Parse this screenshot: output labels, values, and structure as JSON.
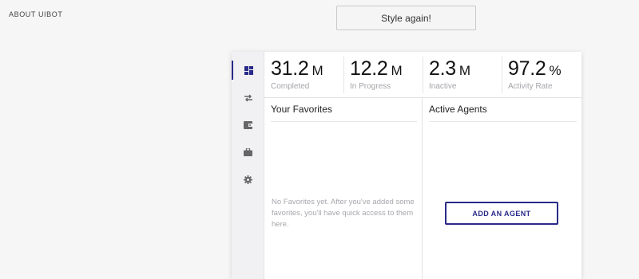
{
  "header": {
    "about_link": "ABOUT UIBOT",
    "style_again_button": "Style again!"
  },
  "sidebar": {
    "items": [
      {
        "icon": "dashboard-icon",
        "active": true
      },
      {
        "icon": "transfer-arrows-icon",
        "active": false
      },
      {
        "icon": "wallet-icon",
        "active": false
      },
      {
        "icon": "briefcase-icon",
        "active": false
      },
      {
        "icon": "gear-icon",
        "active": false
      }
    ],
    "active_color": "#2a2a8a"
  },
  "stats": [
    {
      "value": "31.2",
      "unit": "M",
      "label": "Completed"
    },
    {
      "value": "12.2",
      "unit": "M",
      "label": "In Progress"
    },
    {
      "value": "2.3",
      "unit": "M",
      "label": "Inactive"
    },
    {
      "value": "97.2",
      "unit": "%",
      "label": "Activity Rate"
    }
  ],
  "favorites": {
    "title": "Your Favorites",
    "empty_text": "No Favorites yet. After you've added some favorites, you'll have quick access to them here."
  },
  "agents": {
    "title": "Active Agents",
    "add_button": "ADD AN AGENT"
  },
  "colors": {
    "accent": "#2a2a8a",
    "muted_text": "#a7a7ad",
    "background": "#f6f6f6"
  }
}
